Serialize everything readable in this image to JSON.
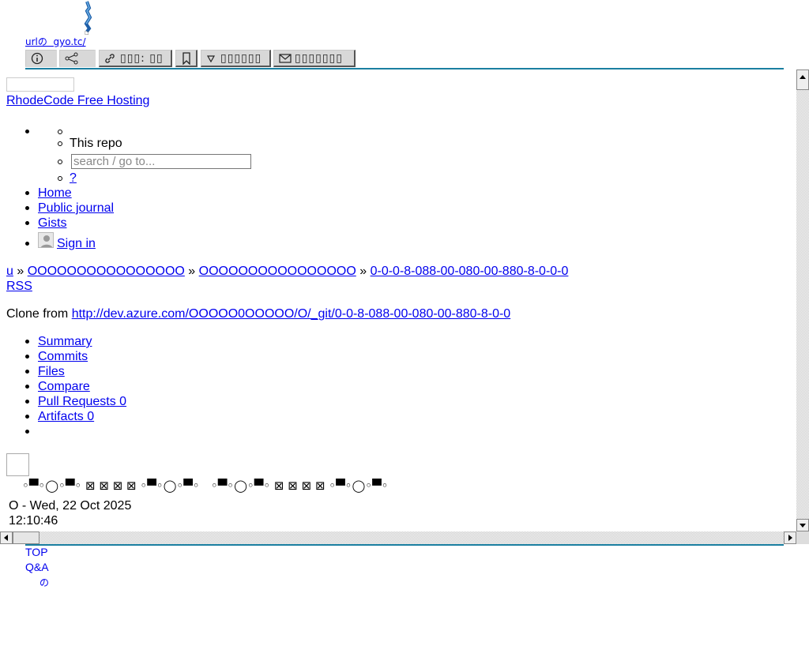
{
  "wrapper": {
    "url_text": "urlの  gyo.tc/",
    "toolbar": {
      "info_icon": "info-icon",
      "share_icon": "share-icon",
      "link_label": "▯▯▯: ▯▯",
      "bookmark_icon": "bookmark-icon",
      "filter_label": "▯▯▯▯▯▯",
      "mail_label": "▯▯▯▯▯▯▯"
    },
    "accent_color": "#1b7fa1",
    "bottom_links": {
      "top": "TOP",
      "qa": "Q&A",
      "misc": "の"
    }
  },
  "page": {
    "site_title": "RhodeCode Free Hosting",
    "search_scope": "This repo",
    "search_placeholder": "search / go to...",
    "help_link": "?",
    "nav": [
      "Home",
      "Public journal",
      "Gists"
    ],
    "sign_in": "Sign in",
    "breadcrumb": {
      "root": "u",
      "sep": "»",
      "level1": "OOOOOOOOOOOOOOOO",
      "level2": "OOOOOOOOOOOOOOOO",
      "repo": "0-0-0-8-088-00-080-00-880-8-0-0-0"
    },
    "rss": "RSS",
    "clone_label": "Clone from",
    "clone_url": "http://dev.azure.com/OOOOO0OOOOO/O/_git/0-0-8-088-00-080-00-880-8-0-0",
    "tabs": [
      "Summary",
      "Commits",
      "Files",
      "Compare",
      "Pull Requests 0",
      "Artifacts 0"
    ],
    "glyph_row": "◦▀◦◯◦▀◦ ⊠ ⊠ ⊠ ⊠ ◦▀◦◯◦▀◦   ◦▀◦◯◦▀◦ ⊠ ⊠ ⊠ ⊠ ◦▀◦◯◦▀◦",
    "footer": "O - Wed, 22 Oct 2025 12:10:46"
  }
}
